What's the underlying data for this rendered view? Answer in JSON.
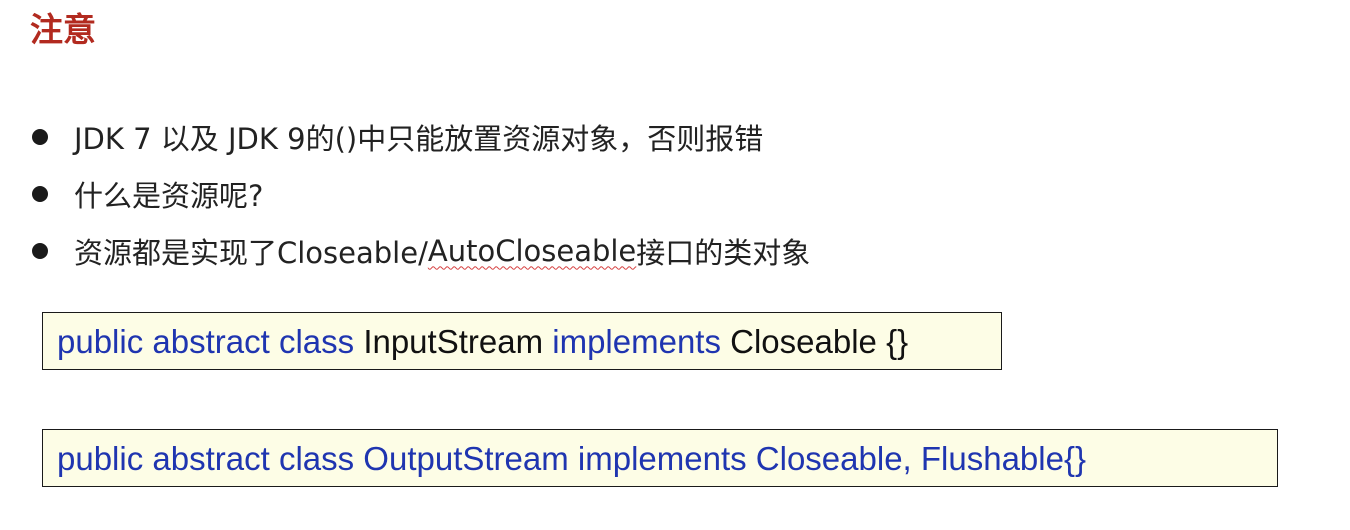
{
  "heading": "注意",
  "bullets": [
    {
      "text_before": "JDK 7 以及 JDK 9的()中只能放置资源对象，否则报错",
      "squiggle": "",
      "text_after": ""
    },
    {
      "text_before": "什么是资源呢?",
      "squiggle": "",
      "text_after": ""
    },
    {
      "text_before": "资源都是实现了Closeable/",
      "squiggle": "AutoCloseable",
      "text_after": "接口的类对象"
    }
  ],
  "code_blocks": [
    {
      "segments": [
        {
          "text": "public abstract class ",
          "style": "keyword"
        },
        {
          "text": "InputStream ",
          "style": "plain"
        },
        {
          "text": "implements ",
          "style": "keyword"
        },
        {
          "text": "Closeable {}",
          "style": "plain"
        }
      ]
    },
    {
      "segments": [
        {
          "text": "public abstract class OutputStream implements Closeable, Flushable{}",
          "style": "keyword"
        }
      ]
    }
  ],
  "colors": {
    "heading": "#b22a1f",
    "keyword": "#1f35b0",
    "plain": "#111111",
    "code_background": "#fdfde6"
  }
}
